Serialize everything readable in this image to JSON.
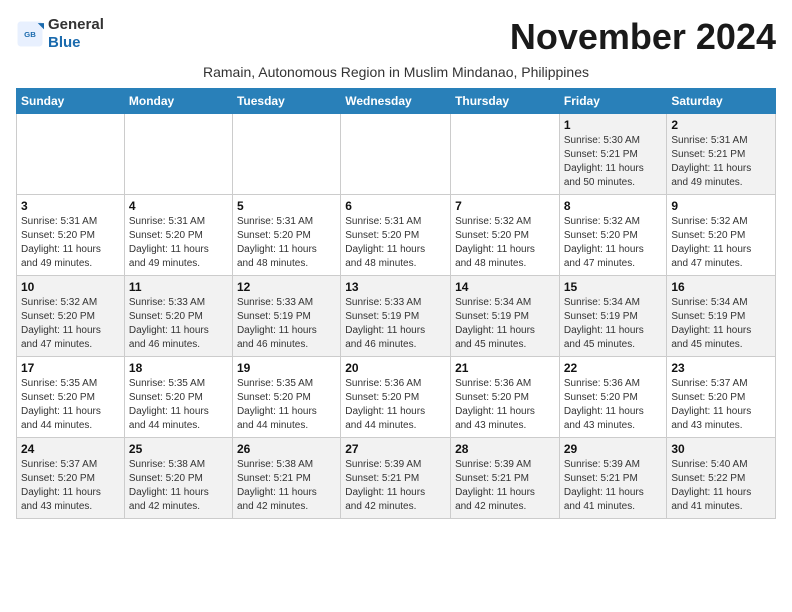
{
  "header": {
    "logo_general": "General",
    "logo_blue": "Blue",
    "month_title": "November 2024",
    "subtitle": "Ramain, Autonomous Region in Muslim Mindanao, Philippines"
  },
  "calendar": {
    "days_of_week": [
      "Sunday",
      "Monday",
      "Tuesday",
      "Wednesday",
      "Thursday",
      "Friday",
      "Saturday"
    ],
    "weeks": [
      [
        {
          "day": "",
          "info": ""
        },
        {
          "day": "",
          "info": ""
        },
        {
          "day": "",
          "info": ""
        },
        {
          "day": "",
          "info": ""
        },
        {
          "day": "",
          "info": ""
        },
        {
          "day": "1",
          "info": "Sunrise: 5:30 AM\nSunset: 5:21 PM\nDaylight: 11 hours\nand 50 minutes."
        },
        {
          "day": "2",
          "info": "Sunrise: 5:31 AM\nSunset: 5:21 PM\nDaylight: 11 hours\nand 49 minutes."
        }
      ],
      [
        {
          "day": "3",
          "info": "Sunrise: 5:31 AM\nSunset: 5:20 PM\nDaylight: 11 hours\nand 49 minutes."
        },
        {
          "day": "4",
          "info": "Sunrise: 5:31 AM\nSunset: 5:20 PM\nDaylight: 11 hours\nand 49 minutes."
        },
        {
          "day": "5",
          "info": "Sunrise: 5:31 AM\nSunset: 5:20 PM\nDaylight: 11 hours\nand 48 minutes."
        },
        {
          "day": "6",
          "info": "Sunrise: 5:31 AM\nSunset: 5:20 PM\nDaylight: 11 hours\nand 48 minutes."
        },
        {
          "day": "7",
          "info": "Sunrise: 5:32 AM\nSunset: 5:20 PM\nDaylight: 11 hours\nand 48 minutes."
        },
        {
          "day": "8",
          "info": "Sunrise: 5:32 AM\nSunset: 5:20 PM\nDaylight: 11 hours\nand 47 minutes."
        },
        {
          "day": "9",
          "info": "Sunrise: 5:32 AM\nSunset: 5:20 PM\nDaylight: 11 hours\nand 47 minutes."
        }
      ],
      [
        {
          "day": "10",
          "info": "Sunrise: 5:32 AM\nSunset: 5:20 PM\nDaylight: 11 hours\nand 47 minutes."
        },
        {
          "day": "11",
          "info": "Sunrise: 5:33 AM\nSunset: 5:20 PM\nDaylight: 11 hours\nand 46 minutes."
        },
        {
          "day": "12",
          "info": "Sunrise: 5:33 AM\nSunset: 5:19 PM\nDaylight: 11 hours\nand 46 minutes."
        },
        {
          "day": "13",
          "info": "Sunrise: 5:33 AM\nSunset: 5:19 PM\nDaylight: 11 hours\nand 46 minutes."
        },
        {
          "day": "14",
          "info": "Sunrise: 5:34 AM\nSunset: 5:19 PM\nDaylight: 11 hours\nand 45 minutes."
        },
        {
          "day": "15",
          "info": "Sunrise: 5:34 AM\nSunset: 5:19 PM\nDaylight: 11 hours\nand 45 minutes."
        },
        {
          "day": "16",
          "info": "Sunrise: 5:34 AM\nSunset: 5:19 PM\nDaylight: 11 hours\nand 45 minutes."
        }
      ],
      [
        {
          "day": "17",
          "info": "Sunrise: 5:35 AM\nSunset: 5:20 PM\nDaylight: 11 hours\nand 44 minutes."
        },
        {
          "day": "18",
          "info": "Sunrise: 5:35 AM\nSunset: 5:20 PM\nDaylight: 11 hours\nand 44 minutes."
        },
        {
          "day": "19",
          "info": "Sunrise: 5:35 AM\nSunset: 5:20 PM\nDaylight: 11 hours\nand 44 minutes."
        },
        {
          "day": "20",
          "info": "Sunrise: 5:36 AM\nSunset: 5:20 PM\nDaylight: 11 hours\nand 44 minutes."
        },
        {
          "day": "21",
          "info": "Sunrise: 5:36 AM\nSunset: 5:20 PM\nDaylight: 11 hours\nand 43 minutes."
        },
        {
          "day": "22",
          "info": "Sunrise: 5:36 AM\nSunset: 5:20 PM\nDaylight: 11 hours\nand 43 minutes."
        },
        {
          "day": "23",
          "info": "Sunrise: 5:37 AM\nSunset: 5:20 PM\nDaylight: 11 hours\nand 43 minutes."
        }
      ],
      [
        {
          "day": "24",
          "info": "Sunrise: 5:37 AM\nSunset: 5:20 PM\nDaylight: 11 hours\nand 43 minutes."
        },
        {
          "day": "25",
          "info": "Sunrise: 5:38 AM\nSunset: 5:20 PM\nDaylight: 11 hours\nand 42 minutes."
        },
        {
          "day": "26",
          "info": "Sunrise: 5:38 AM\nSunset: 5:21 PM\nDaylight: 11 hours\nand 42 minutes."
        },
        {
          "day": "27",
          "info": "Sunrise: 5:39 AM\nSunset: 5:21 PM\nDaylight: 11 hours\nand 42 minutes."
        },
        {
          "day": "28",
          "info": "Sunrise: 5:39 AM\nSunset: 5:21 PM\nDaylight: 11 hours\nand 42 minutes."
        },
        {
          "day": "29",
          "info": "Sunrise: 5:39 AM\nSunset: 5:21 PM\nDaylight: 11 hours\nand 41 minutes."
        },
        {
          "day": "30",
          "info": "Sunrise: 5:40 AM\nSunset: 5:22 PM\nDaylight: 11 hours\nand 41 minutes."
        }
      ]
    ]
  }
}
